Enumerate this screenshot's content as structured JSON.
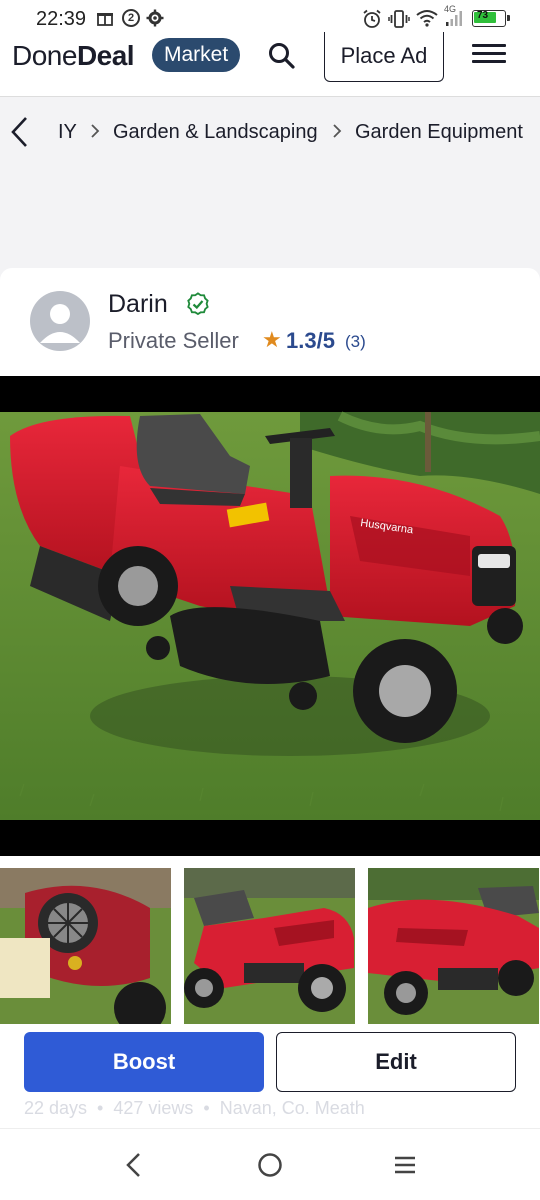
{
  "status_bar": {
    "time": "22:39",
    "badge": "2",
    "network": "4G",
    "battery": "73"
  },
  "header": {
    "logo_light": "Done",
    "logo_bold": "Deal",
    "market_label": "Market",
    "place_ad_label": "Place Ad",
    "icons": [
      "search-icon",
      "hamburger-menu-icon"
    ]
  },
  "breadcrumb": {
    "items": [
      "IY",
      "Garden & Landscaping",
      "Garden Equipment"
    ]
  },
  "seller": {
    "name": "Darin",
    "type": "Private Seller",
    "rating": "1.3/5",
    "rating_count": "(3)"
  },
  "listing": {
    "main_image": "red Husqvarna ride-on lawn mower on grass",
    "brand_decal": "Husqvarna",
    "thumbnails": [
      "mower engine close-up",
      "mower side view",
      "mower front view"
    ]
  },
  "actions": {
    "boost_label": "Boost",
    "edit_label": "Edit"
  },
  "meta": {
    "age": "22 days",
    "views": "427 views",
    "location": "Navan, Co. Meath"
  },
  "colors": {
    "brand_navy": "#2b4a6e",
    "boost_blue": "#2f5bd6",
    "verified_green": "#1f8a3a",
    "star_orange": "#e08a1e"
  }
}
